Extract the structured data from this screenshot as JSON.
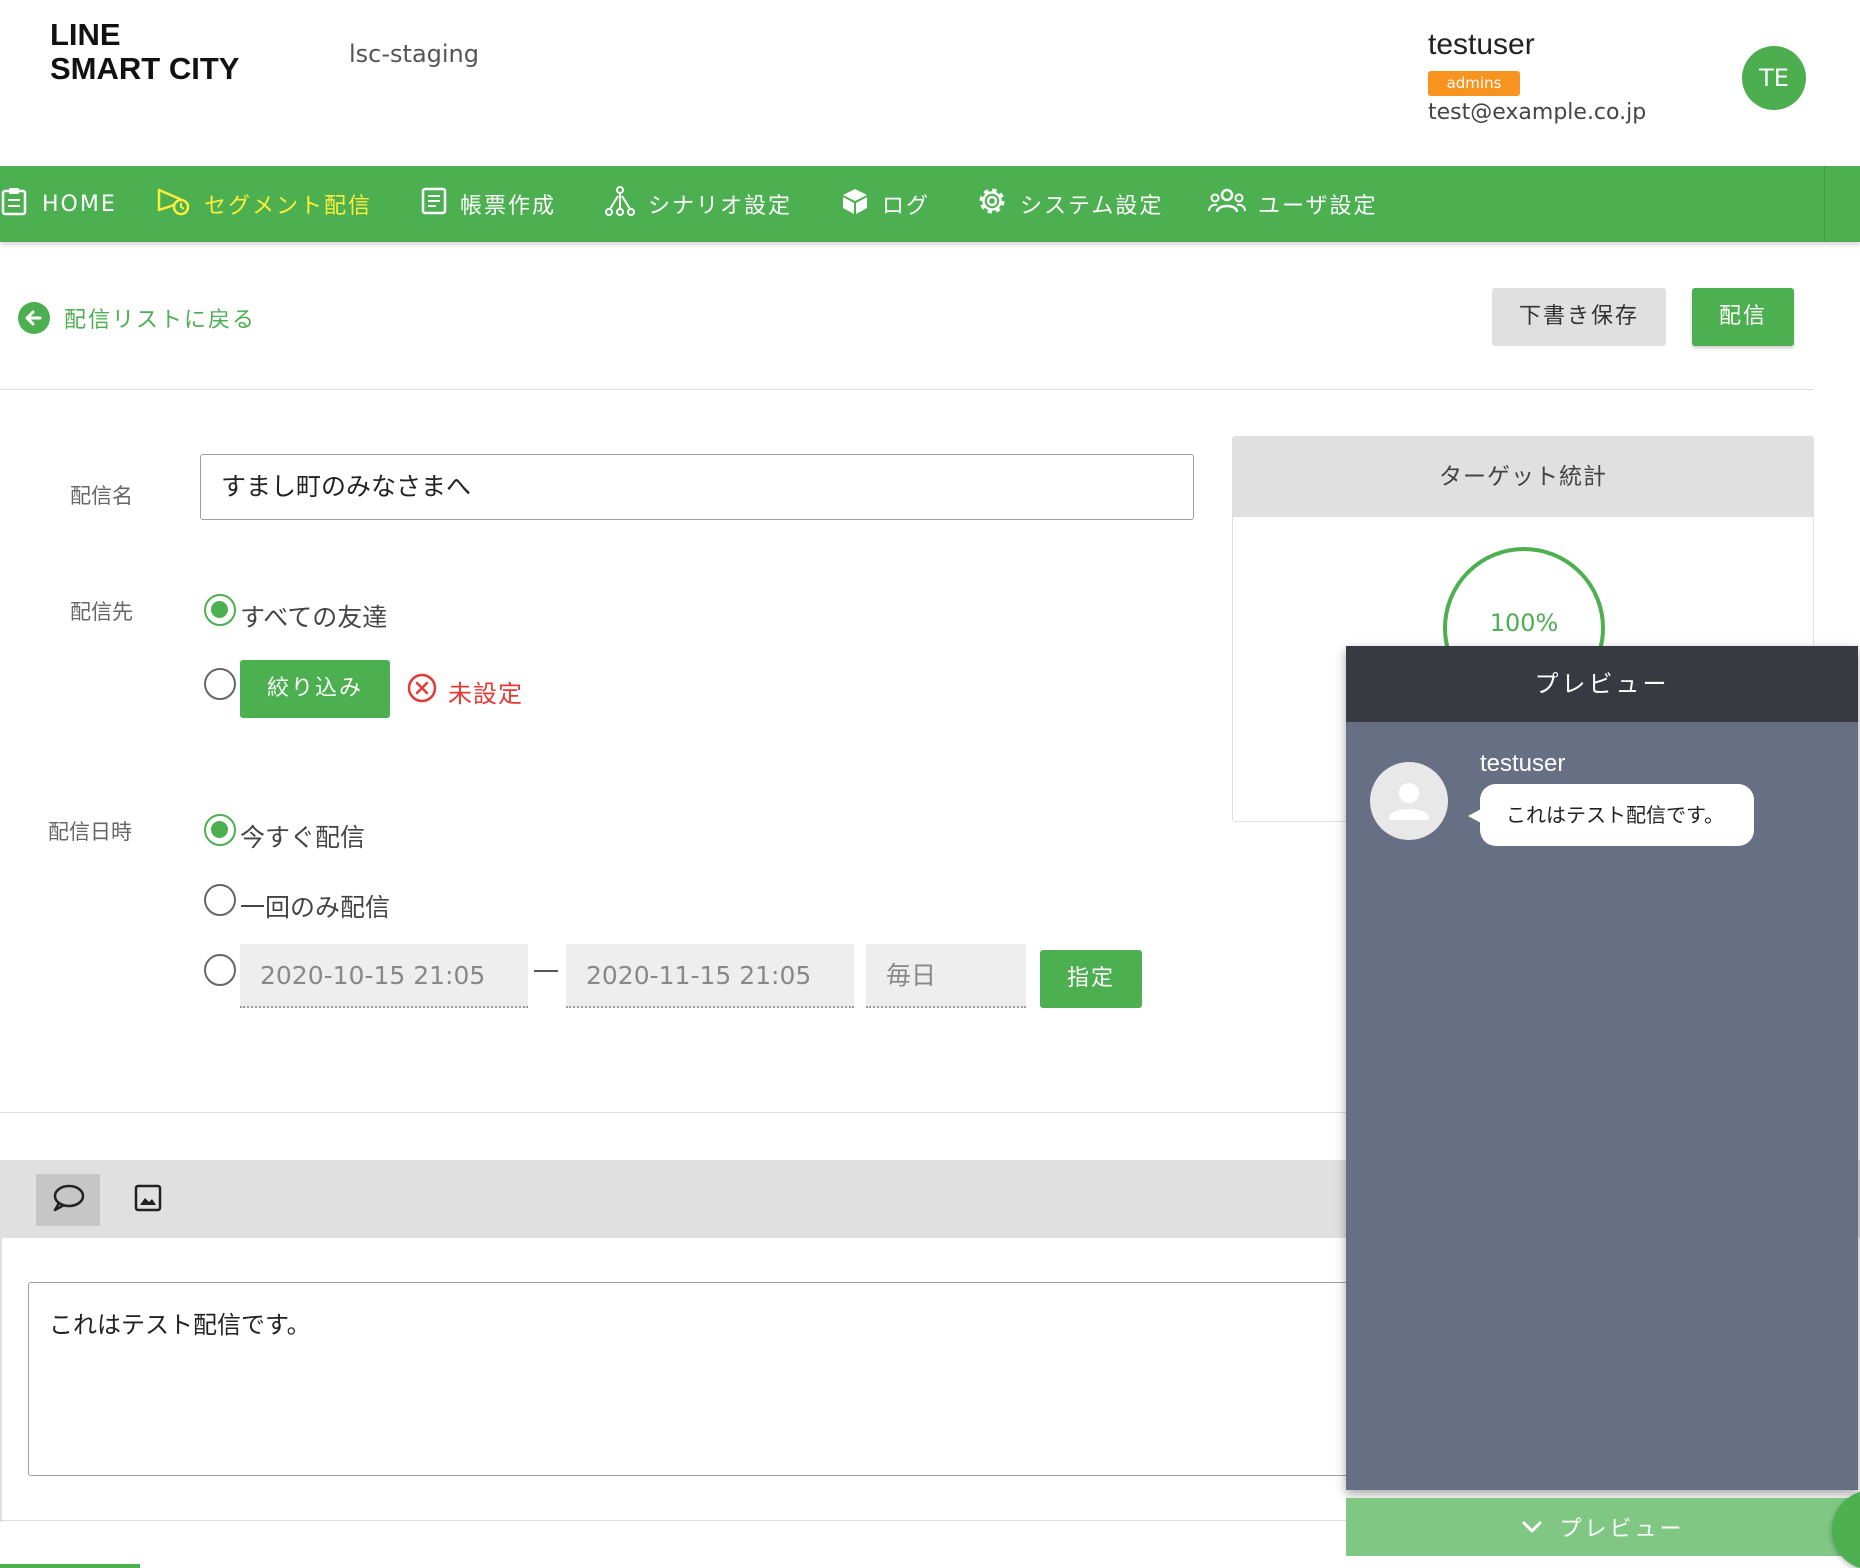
{
  "header": {
    "logo_line1": "LINE",
    "logo_line2": "SMART CITY",
    "environment": "lsc-staging",
    "user": {
      "name": "testuser",
      "role": "admins",
      "email": "test@example.co.jp",
      "initials": "TE"
    }
  },
  "nav": {
    "items": [
      {
        "label": "HOME",
        "icon": "clipboard-icon"
      },
      {
        "label": "セグメント配信",
        "icon": "megaphone-icon",
        "active": true
      },
      {
        "label": "帳票作成",
        "icon": "document-icon"
      },
      {
        "label": "シナリオ設定",
        "icon": "scenario-tree-icon"
      },
      {
        "label": "ログ",
        "icon": "box-icon"
      },
      {
        "label": "システム設定",
        "icon": "gear-icon"
      },
      {
        "label": "ユーザ設定",
        "icon": "users-icon"
      }
    ]
  },
  "toolbar": {
    "back_label": "配信リストに戻る",
    "draft_label": "下書き保存",
    "send_label": "配信"
  },
  "form": {
    "name_label": "配信名",
    "name_value": "すまし町のみなさまへ",
    "target_label": "配信先",
    "target_all_label": "すべての友達",
    "target_selected": "all",
    "filter_label": "絞り込み",
    "unset_label": "未設定",
    "schedule_label": "配信日時",
    "schedule_now_label": "今すぐ配信",
    "schedule_once_label": "一回のみ配信",
    "schedule_selected": "now",
    "range_start": "2020-10-15 21:05",
    "range_end": "2020-11-15 21:05",
    "frequency": "毎日",
    "specify_label": "指定"
  },
  "stats": {
    "title": "ターゲット統計",
    "percent": 100,
    "percent_label": "100%"
  },
  "editor": {
    "tools": [
      {
        "icon": "speech-bubble-icon",
        "active": true
      },
      {
        "icon": "image-icon",
        "active": false
      }
    ],
    "message": "これはテスト配信です。"
  },
  "preview": {
    "title": "プレビュー",
    "sender": "testuser",
    "bubble_text": "これはテスト配信です。",
    "toggle_label": "プレビュー"
  },
  "colors": {
    "brand_green": "#4caf50",
    "nav_active": "#ffee3b",
    "badge_orange": "#f7931e",
    "error_red": "#e53935",
    "preview_bg": "#666f84",
    "preview_header": "#373b41"
  }
}
